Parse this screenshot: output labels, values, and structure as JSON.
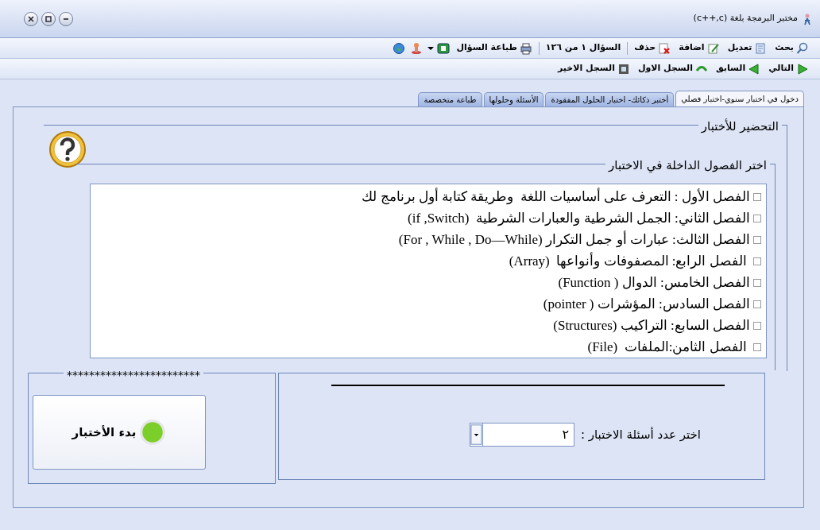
{
  "window": {
    "title": "مختبر البرمجة بلغة (c++,c)"
  },
  "toolbar": [
    {
      "kind": "search",
      "label": "بحث"
    },
    {
      "kind": "edit",
      "label": "تعديل"
    },
    {
      "kind": "add",
      "label": "اضافة"
    },
    {
      "kind": "delete",
      "label": "حذف"
    },
    {
      "kind": "separator"
    },
    {
      "kind": "counter",
      "label": "السؤال ١ من ١٢٦"
    },
    {
      "kind": "separator"
    },
    {
      "kind": "print",
      "label": "طباعة السؤال"
    },
    {
      "kind": "bmenu"
    },
    {
      "kind": "stamp"
    },
    {
      "kind": "globe"
    }
  ],
  "navbar": [
    {
      "kind": "next",
      "label": "التالي"
    },
    {
      "kind": "prev",
      "label": "السابق"
    },
    {
      "kind": "first",
      "label": "السجل الاول"
    },
    {
      "kind": "last",
      "label": "السجل الاخير"
    }
  ],
  "tabs": [
    {
      "label": "دخول في اختبار سنوي-اختبار فصلي",
      "selected": true
    },
    {
      "label": "أختبر ذكائك- اختبار الحلول المفقودة",
      "selected": false
    },
    {
      "label": "الأسئلة وحلولها",
      "selected": false
    },
    {
      "label": "طباعة متخصصة",
      "selected": false
    }
  ],
  "prepare": {
    "title": "التحضير للأختبار",
    "chapters_title": "اختر الفصول الداخلة في الاختبار",
    "chapters": [
      {
        "label": "الفصل الأول : التعرف على أساسيات اللغة  وطريقة كتابة أول برنامج لك",
        "checked": false
      },
      {
        "label": "الفصل الثاني: الجمل الشرطية والعبارات الشرطية  (if ,Switch)",
        "checked": false
      },
      {
        "label": "الفصل الثالث: عبارات أو جمل التكرار (For , While , Do—While)",
        "checked": false
      },
      {
        "label": " الفصل الرابع: المصفوفات وأنواعها  (Array)",
        "checked": false
      },
      {
        "label": "الفصل الخامس: الدوال ( Function)",
        "checked": false
      },
      {
        "label": "الفصل السادس: المؤشرات ( pointer)",
        "checked": false
      },
      {
        "label": "الفصل السابع: التراكيب (Structures)",
        "checked": false
      },
      {
        "label": " الفصل الثامن:الملفات  (File)",
        "checked": false
      }
    ]
  },
  "start": {
    "legend": "************************",
    "button": "بدء الأختبار"
  },
  "count": {
    "label": "اختر عدد أسئلة الاختبار  :",
    "value": "٢"
  }
}
